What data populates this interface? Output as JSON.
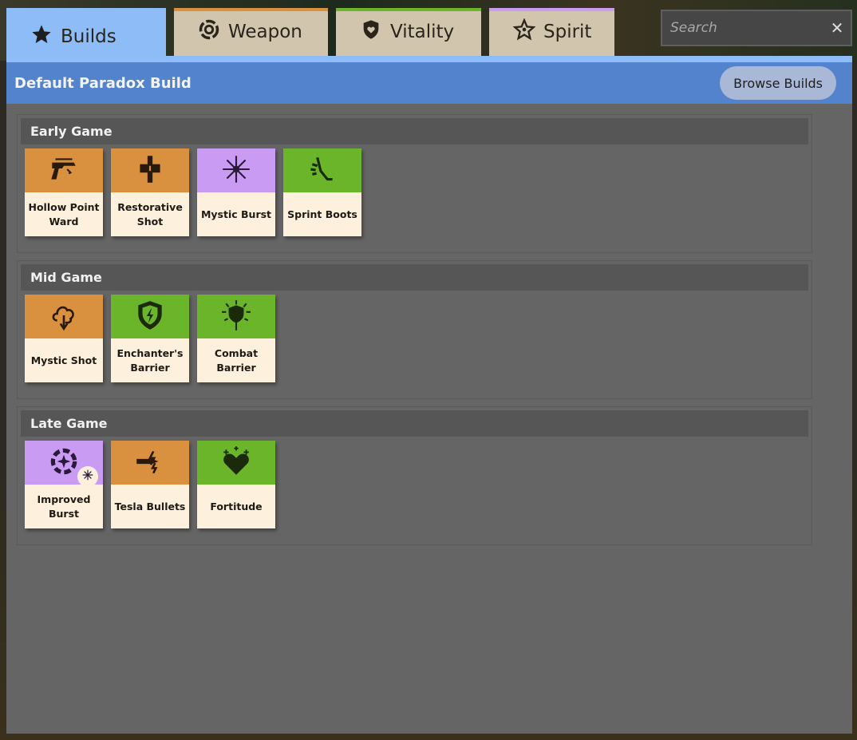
{
  "tabs": [
    {
      "label": "Builds",
      "icon": "star-icon",
      "active": true
    },
    {
      "label": "Weapon",
      "icon": "weapon-ring-icon",
      "accent": "#d9913f"
    },
    {
      "label": "Vitality",
      "icon": "shield-heart-icon",
      "accent": "#6bb52a"
    },
    {
      "label": "Spirit",
      "icon": "spirit-star-icon",
      "accent": "#c99bf3"
    }
  ],
  "search": {
    "placeholder": "Search",
    "value": ""
  },
  "header": {
    "title": "Default Paradox Build",
    "browse_label": "Browse Builds"
  },
  "colors": {
    "weapon": "#d9913f",
    "vitality": "#6bb52a",
    "spirit": "#c99bf3",
    "active_tab": "#8ebcf7",
    "header": "#5383cc"
  },
  "sections": [
    {
      "title": "Early Game",
      "items": [
        {
          "name": "Hollow Point Ward",
          "category": "weapon",
          "icon": "pistol-icon"
        },
        {
          "name": "Restorative Shot",
          "category": "weapon",
          "icon": "restorative-shot-icon"
        },
        {
          "name": "Mystic Burst",
          "category": "spirit",
          "icon": "burst-icon"
        },
        {
          "name": "Sprint Boots",
          "category": "vitality",
          "icon": "boots-icon"
        }
      ]
    },
    {
      "title": "Mid Game",
      "items": [
        {
          "name": "Mystic Shot",
          "category": "weapon",
          "icon": "mystic-shot-icon"
        },
        {
          "name": "Enchanter's Barrier",
          "category": "vitality",
          "icon": "lightning-shield-icon"
        },
        {
          "name": "Combat Barrier",
          "category": "vitality",
          "icon": "combat-barrier-icon"
        }
      ]
    },
    {
      "title": "Late Game",
      "items": [
        {
          "name": "Improved Burst",
          "category": "spirit",
          "icon": "improved-burst-icon",
          "badge": "burst-icon"
        },
        {
          "name": "Tesla Bullets",
          "category": "weapon",
          "icon": "tesla-bullet-icon"
        },
        {
          "name": "Fortitude",
          "category": "vitality",
          "icon": "heart-icon"
        }
      ]
    }
  ]
}
